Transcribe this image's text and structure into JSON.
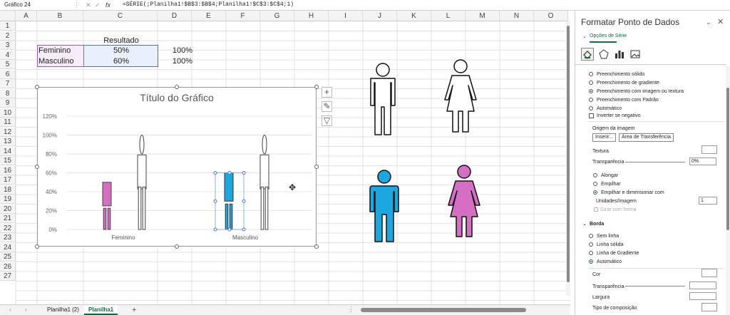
{
  "formula_bar": {
    "name_box": "Gráfico 24",
    "fx": "fx",
    "formula": "=SÉRIE(;Planilha1!$B$3:$B$4;Planilha1!$C$3:$C$4;1)"
  },
  "columns": [
    "A",
    "B",
    "C",
    "D",
    "E",
    "F",
    "G",
    "H",
    "I",
    "J",
    "K",
    "L",
    "M",
    "N",
    "O"
  ],
  "rows": [
    "1",
    "2",
    "3",
    "4",
    "5",
    "6",
    "7",
    "8",
    "9",
    "10",
    "11",
    "12",
    "13",
    "14",
    "15",
    "16",
    "17",
    "18",
    "19",
    "20",
    "21",
    "22",
    "23",
    "24",
    "25",
    "26",
    "27"
  ],
  "cells": {
    "c2": "Resultado",
    "b3": "Feminino",
    "c3": "50%",
    "d3": "100%",
    "b4": "Masculino",
    "c4": "60%",
    "d4": "100%"
  },
  "chart": {
    "title": "Título do Gráfico",
    "buttons": [
      "+",
      "✎",
      "▽"
    ]
  },
  "chart_data": {
    "type": "bar",
    "title": "Título do Gráfico",
    "categories": [
      "Feminino",
      "Masculino"
    ],
    "series": [
      {
        "name": "Resultado",
        "values": [
          50,
          60
        ],
        "color": "#d46fc3"
      },
      {
        "name": "",
        "values": [
          100,
          100
        ],
        "color": "#ffffff"
      }
    ],
    "yticks": [
      "0%",
      "20%",
      "40%",
      "60%",
      "80%",
      "100%",
      "120%"
    ],
    "ylim": [
      0,
      120
    ],
    "grid": true
  },
  "pane": {
    "title": "Formatar Ponto de Dados",
    "subtitle": "Opções de Série",
    "fill_options": [
      "Preenchimento sólido",
      "Preenchimento de gradiente",
      "Preenchimento com imagem ou textura",
      "Preenchimento com Padrão",
      "Automático"
    ],
    "invert": "Inverter se negativo",
    "image_source": "Origem da imagem",
    "insert": "Inserir...",
    "clipboard": "Área de Transferência",
    "texture": "Textura",
    "transparency": "Transparência",
    "transparency_value": "0%",
    "stretch_options": [
      "Alongar",
      "Empilhar",
      "Empilhar e dimensionar com"
    ],
    "units": "Unidades/Imagem",
    "units_value": "1",
    "rotate": "Girar com forma",
    "border": "Borda",
    "border_options": [
      "Sem linha",
      "Linha sólida",
      "Linha de Gradiente",
      "Automático"
    ],
    "color": "Cor",
    "transparency2": "Transparência",
    "width": "Largura",
    "compound": "Tipo de composição"
  },
  "tabs": [
    "Planilha1 (2)",
    "Planilha1"
  ],
  "icons": {
    "man_blue": "#1ba8e0",
    "woman_pink": "#d46fc3"
  }
}
